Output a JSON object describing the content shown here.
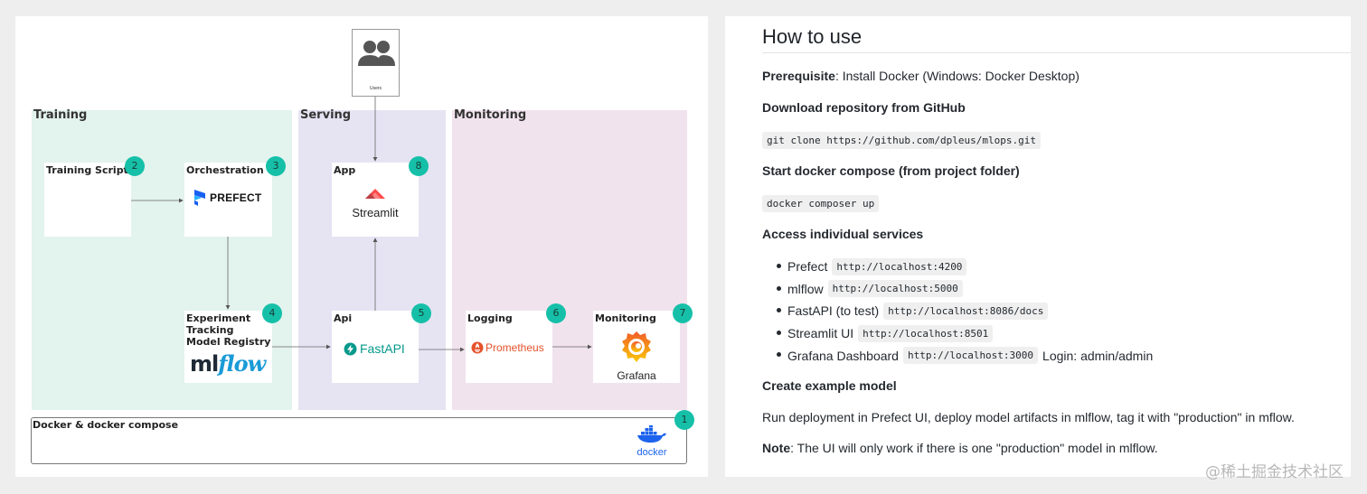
{
  "diagram": {
    "users_label": "Users",
    "regions": {
      "training": "Training",
      "serving": "Serving",
      "monitoring": "Monitoring"
    },
    "cards": {
      "training_script": {
        "label": "Training Script",
        "badge": "2"
      },
      "orchestration": {
        "label": "Orchestration",
        "badge": "3",
        "logo_text": "PREFECT"
      },
      "experiment": {
        "label_line1": "Experiment",
        "label_line2": "Tracking",
        "label_line3": "Model Registry",
        "badge": "4",
        "logo_ml": "ml",
        "logo_flow": "flow"
      },
      "app": {
        "label": "App",
        "badge": "8",
        "logo_text": "Streamlit"
      },
      "api": {
        "label": "Api",
        "badge": "5",
        "logo_text": "FastAPI"
      },
      "logging": {
        "label": "Logging",
        "badge": "6",
        "logo_text": "Prometheus"
      },
      "monitoring": {
        "label": "Monitoring",
        "badge": "7",
        "logo_text": "Grafana"
      }
    },
    "docker": {
      "label": "Docker & docker compose",
      "badge": "1",
      "logo_text": "docker"
    },
    "colors": {
      "badge": "#16c0a8",
      "training": "#e3f3ee",
      "serving": "#e6e4f3",
      "monitoring": "#f1e3ee"
    }
  },
  "panel": {
    "title": "How to use",
    "prerequisite_label": "Prerequisite",
    "prerequisite_text": ": Install Docker (Windows: Docker Desktop)",
    "download_heading": "Download repository from GitHub",
    "clone_cmd": "git clone https://github.com/dpleus/mlops.git",
    "compose_heading": "Start docker compose (from project folder)",
    "compose_cmd": "docker composer up",
    "access_heading": "Access individual services",
    "services": [
      {
        "name": "Prefect",
        "url": "http://localhost:4200",
        "suffix": ""
      },
      {
        "name": "mlflow",
        "url": "http://localhost:5000",
        "suffix": ""
      },
      {
        "name": "FastAPI (to test)",
        "url": "http://localhost:8086/docs",
        "suffix": ""
      },
      {
        "name": "Streamlit UI",
        "url": "http://localhost:8501",
        "suffix": ""
      },
      {
        "name": "Grafana Dashboard",
        "url": "http://localhost:3000",
        "suffix": "Login: admin/admin"
      }
    ],
    "create_heading": "Create example model",
    "run_text": "Run deployment in Prefect UI, deploy model artifacts in mlflow, tag it with \"production\" in mflow.",
    "note_label": "Note",
    "note_text": ": The UI will only work if there is one \"production\" model in mlflow."
  },
  "watermark": "@稀土掘金技术社区"
}
